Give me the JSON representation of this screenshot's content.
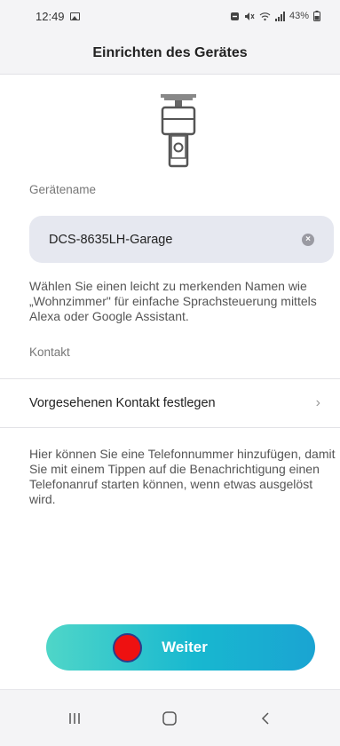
{
  "status_bar": {
    "time": "12:49",
    "battery": "43%",
    "icons": [
      "image-icon",
      "dnd-icon",
      "wifi-icon",
      "signal-icon",
      "battery-icon"
    ]
  },
  "header": {
    "title": "Einrichten des Gerätes"
  },
  "device": {
    "icon": "camera-device-icon"
  },
  "form": {
    "name_label": "Gerätename",
    "name_value": "DCS-8635LH-Garage",
    "name_hint": "Wählen Sie einen leicht zu merkenden Namen wie „Wohnzimmer\" für einfache Sprachsteuerung mittels Alexa oder Google Assistant.",
    "contact_label": "Kontakt",
    "contact_row_label": "Vorgesehenen Kontakt festlegen",
    "contact_info": "Hier können Sie eine Telefonnummer hinzufügen, damit Sie mit einem Tippen auf die Benachrichtigung einen Telefonanruf starten können, wenn etwas ausgelöst wird."
  },
  "actions": {
    "next_label": "Weiter"
  },
  "nav_bar": {
    "items": [
      "recent-apps-icon",
      "home-icon",
      "back-icon"
    ]
  },
  "colors": {
    "accent_start": "#4fd6c8",
    "accent_end": "#1aa4d2",
    "field_bg": "#e6e8f0",
    "record_dot": "#ee1111"
  }
}
